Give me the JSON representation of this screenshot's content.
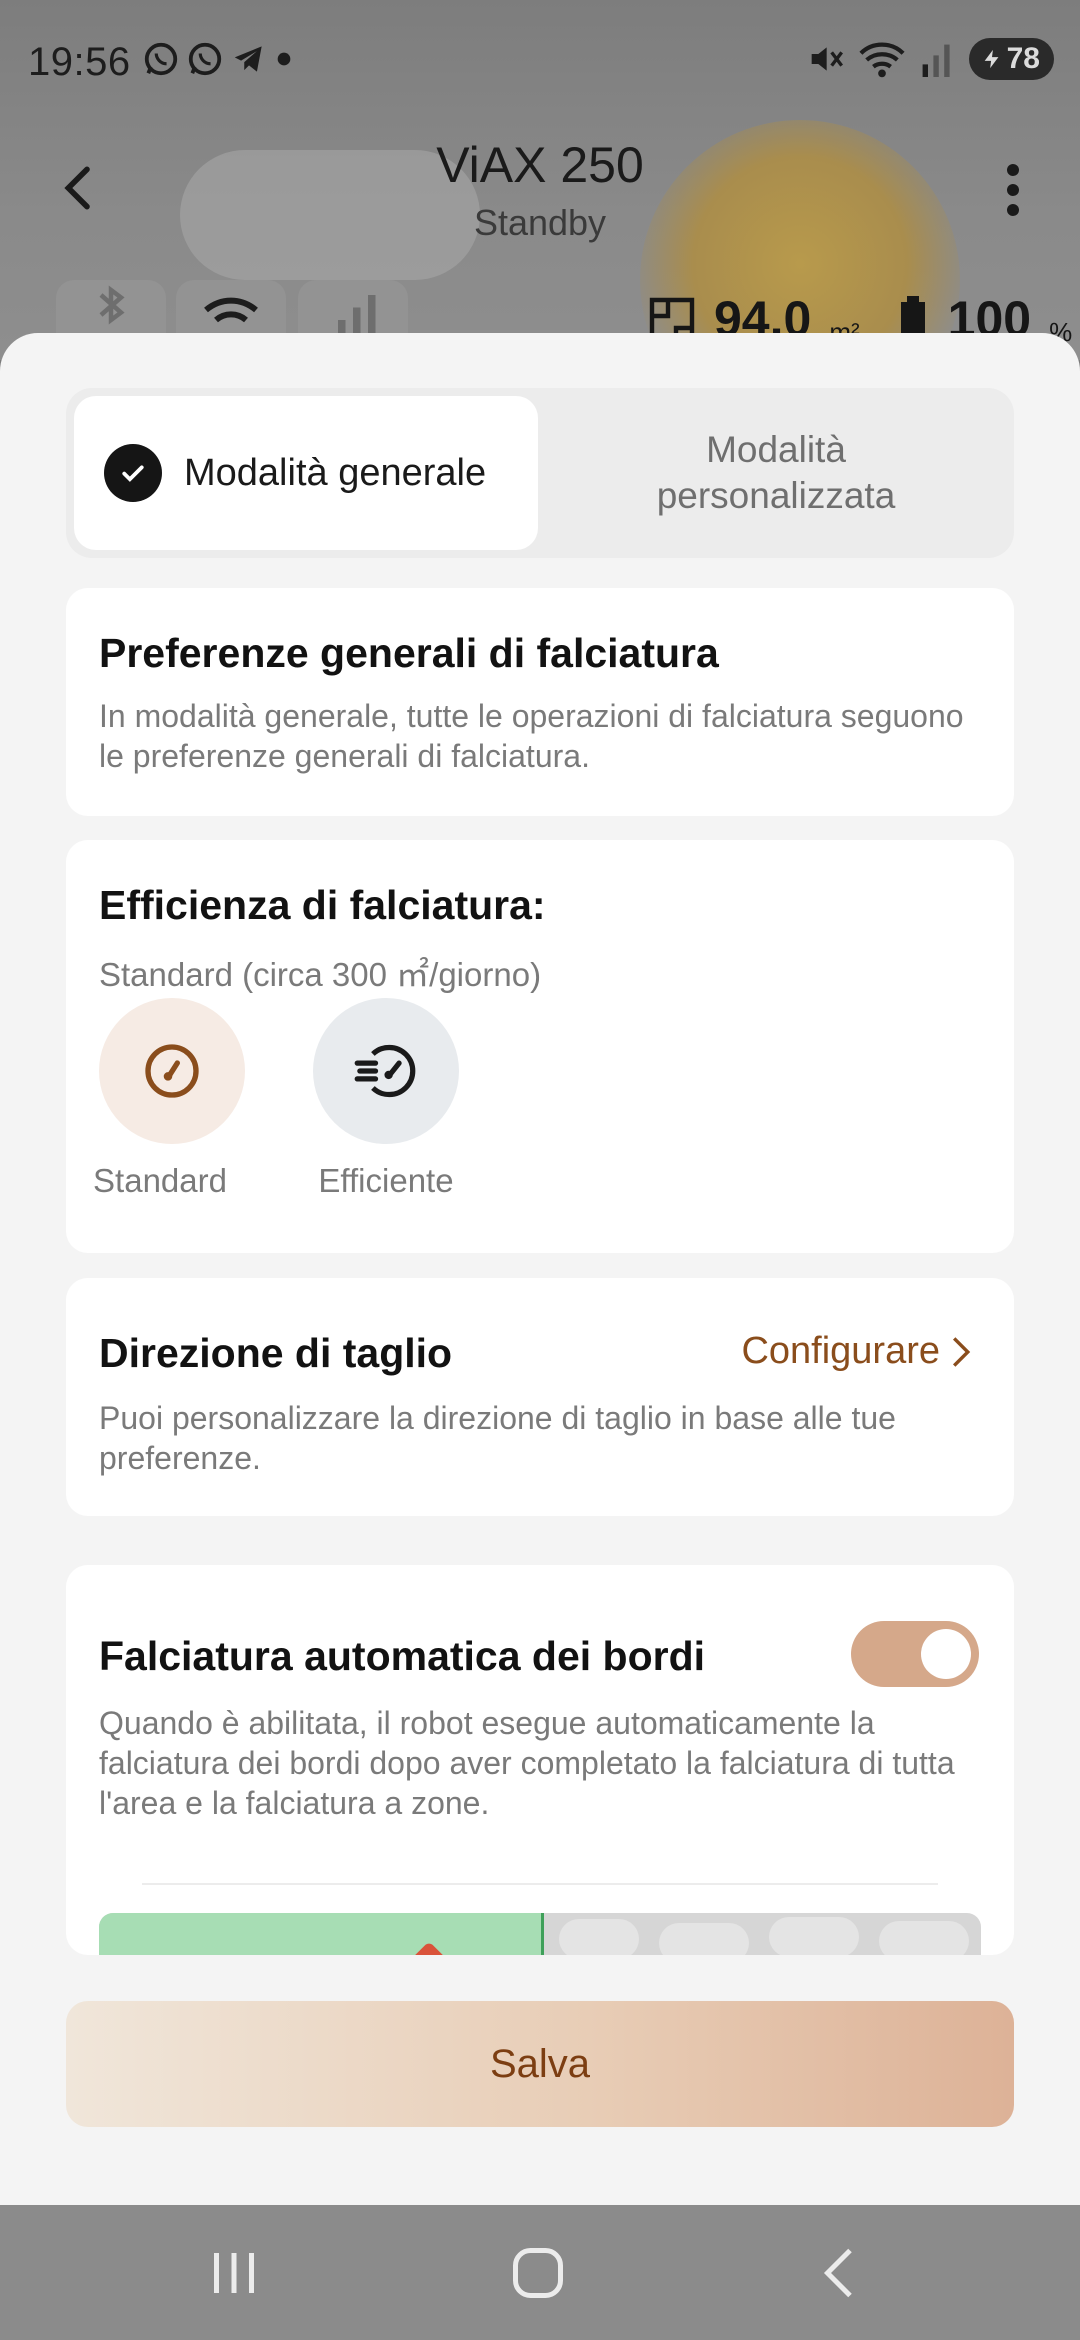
{
  "status_bar": {
    "time": "19:56",
    "left_icons": [
      "whatsapp-icon",
      "whatsapp-icon",
      "telegram-icon",
      "dot-icon"
    ],
    "right_icons": [
      "mute-icon",
      "wifi-icon",
      "signal-icon"
    ],
    "battery": "78"
  },
  "header": {
    "title": "ViAX 250",
    "subtitle": "Standby",
    "area_value": "94.0",
    "area_unit": "m²",
    "battery_value": "100",
    "battery_unit": "%"
  },
  "mode_tabs": {
    "general": "Modalità generale",
    "custom": "Modalità\npersonalizzata"
  },
  "general_prefs": {
    "title": "Preferenze generali di falciatura",
    "description": "In modalità generale, tutte le operazioni di falciatura seguono le preferenze generali di falciatura."
  },
  "efficiency": {
    "title": "Efficienza di falciatura:",
    "subtitle": "Standard (circa 300 ㎡/giorno)",
    "options": [
      {
        "label": "Standard",
        "selected": true
      },
      {
        "label": "Efficiente",
        "selected": false
      }
    ]
  },
  "cut_direction": {
    "title": "Direzione di taglio",
    "link": "Configurare",
    "description": "Puoi personalizzare la direzione di taglio in base alle tue preferenze."
  },
  "edge_mowing": {
    "title": "Falciatura automatica dei bordi",
    "enabled": true,
    "description": "Quando è abilitata, il robot esegue automaticamente la falciatura dei bordi dopo aver completato la falciatura di tutta l'area e la falciatura a zone."
  },
  "save_label": "Salva",
  "colors": {
    "accent": "#8a4d1c",
    "toggle_on": "#d5a88a",
    "standard_bg": "#f6ebe4",
    "efficient_bg": "#e8ebee"
  }
}
